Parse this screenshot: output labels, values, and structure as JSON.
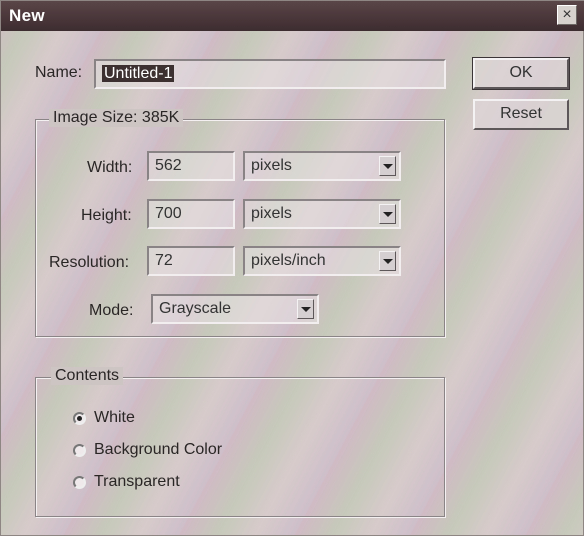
{
  "window": {
    "title": "New",
    "close_glyph": "×"
  },
  "name": {
    "label": "Name:",
    "value": "Untitled-1"
  },
  "buttons": {
    "ok": "OK",
    "reset": "Reset"
  },
  "image_size": {
    "legend": "Image Size: 385K",
    "width": {
      "label": "Width:",
      "value": "562",
      "unit": "pixels"
    },
    "height": {
      "label": "Height:",
      "value": "700",
      "unit": "pixels"
    },
    "resolution": {
      "label": "Resolution:",
      "value": "72",
      "unit": "pixels/inch"
    },
    "mode": {
      "label": "Mode:",
      "value": "Grayscale"
    }
  },
  "contents": {
    "legend": "Contents",
    "options": [
      {
        "label": "White",
        "selected": true
      },
      {
        "label": "Background Color",
        "selected": false
      },
      {
        "label": "Transparent",
        "selected": false
      }
    ]
  }
}
